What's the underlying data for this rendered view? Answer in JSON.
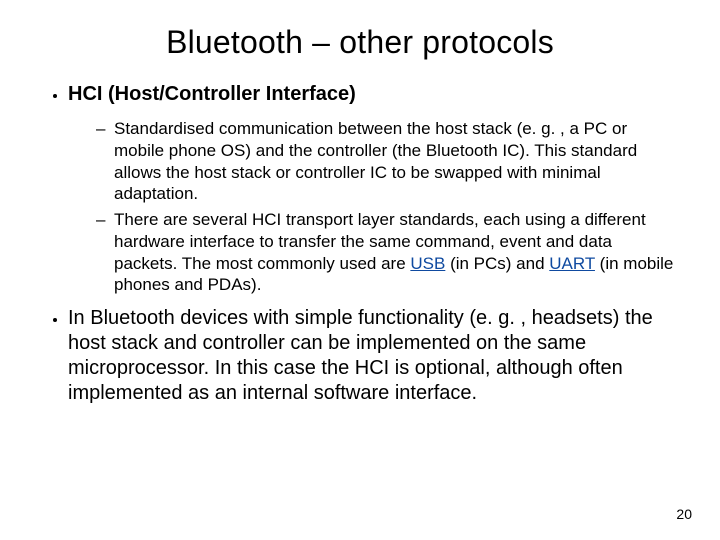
{
  "title": "Bluetooth – other protocols",
  "bullets": {
    "b1": {
      "heading": "HCI (Host/Controller Interface)",
      "sub": [
        "Standardised communication between the host stack (e. g. , a PC or mobile phone OS) and the controller (the Bluetooth IC). This standard allows the host stack or controller IC to be swapped with minimal adaptation.",
        {
          "pre": "There are several HCI transport layer standards, each using a different hardware interface to transfer the same command, event and data packets. The most commonly used are ",
          "link1": "USB",
          "mid": " (in PCs) and ",
          "link2": "UART",
          "post": " (in mobile phones and PDAs)."
        }
      ]
    },
    "b2": "In Bluetooth devices with simple functionality (e. g. , headsets) the host stack and controller can be implemented on the same microprocessor. In this case the HCI is optional, although often implemented as an internal software interface."
  },
  "page_number": "20"
}
